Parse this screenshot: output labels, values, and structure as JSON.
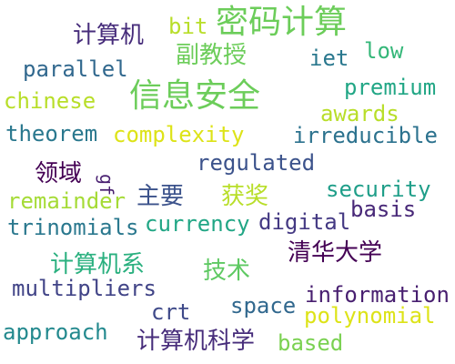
{
  "words": {
    "w01": {
      "text": "密码计算",
      "color": "#6ccd5a"
    },
    "w02": {
      "text": "信息安全",
      "color": "#6ccd5a"
    },
    "w03": {
      "text": "计算机",
      "color": "#472d7b"
    },
    "w04": {
      "text": "bit",
      "color": "#b8de29"
    },
    "w05": {
      "text": "副教授",
      "color": "#6ccd5a"
    },
    "w06": {
      "text": "iet",
      "color": "#2a788e"
    },
    "w07": {
      "text": "low",
      "color": "#35b779"
    },
    "w08": {
      "text": "parallel",
      "color": "#31688e"
    },
    "w09": {
      "text": "chinese",
      "color": "#b8de29"
    },
    "w10": {
      "text": "premium",
      "color": "#21a685"
    },
    "w11": {
      "text": "awards",
      "color": "#b8de29"
    },
    "w12": {
      "text": "theorem",
      "color": "#2a788e"
    },
    "w13": {
      "text": "complexity",
      "color": "#dde318"
    },
    "w14": {
      "text": "irreducible",
      "color": "#2c728e"
    },
    "w15": {
      "text": "领域",
      "color": "#440154"
    },
    "w16": {
      "text": "gf",
      "color": "#481f70"
    },
    "w17": {
      "text": "regulated",
      "color": "#3b528b"
    },
    "w18": {
      "text": "security",
      "color": "#1f9e89"
    },
    "w19": {
      "text": "remainder",
      "color": "#a5db36"
    },
    "w20": {
      "text": "主要",
      "color": "#3b528b"
    },
    "w21": {
      "text": "获奖",
      "color": "#b8de29"
    },
    "w22": {
      "text": "basis",
      "color": "#482878"
    },
    "w23": {
      "text": "trinomials",
      "color": "#2a788e"
    },
    "w24": {
      "text": "currency",
      "color": "#21a685"
    },
    "w25": {
      "text": "digital",
      "color": "#443983"
    },
    "w26": {
      "text": "计算机系",
      "color": "#2ab07f"
    },
    "w27": {
      "text": "清华大学",
      "color": "#440154"
    },
    "w28": {
      "text": "技术",
      "color": "#5ec962"
    },
    "w29": {
      "text": "multipliers",
      "color": "#414487"
    },
    "w30": {
      "text": "information",
      "color": "#481f70"
    },
    "w31": {
      "text": "space",
      "color": "#31688e"
    },
    "w32": {
      "text": "crt",
      "color": "#3e4989"
    },
    "w33": {
      "text": "polynomial",
      "color": "#dde318"
    },
    "w34": {
      "text": "approach",
      "color": "#23898e"
    },
    "w35": {
      "text": "计算机科学",
      "color": "#472d7b"
    },
    "w36": {
      "text": "based",
      "color": "#7ad151"
    }
  }
}
